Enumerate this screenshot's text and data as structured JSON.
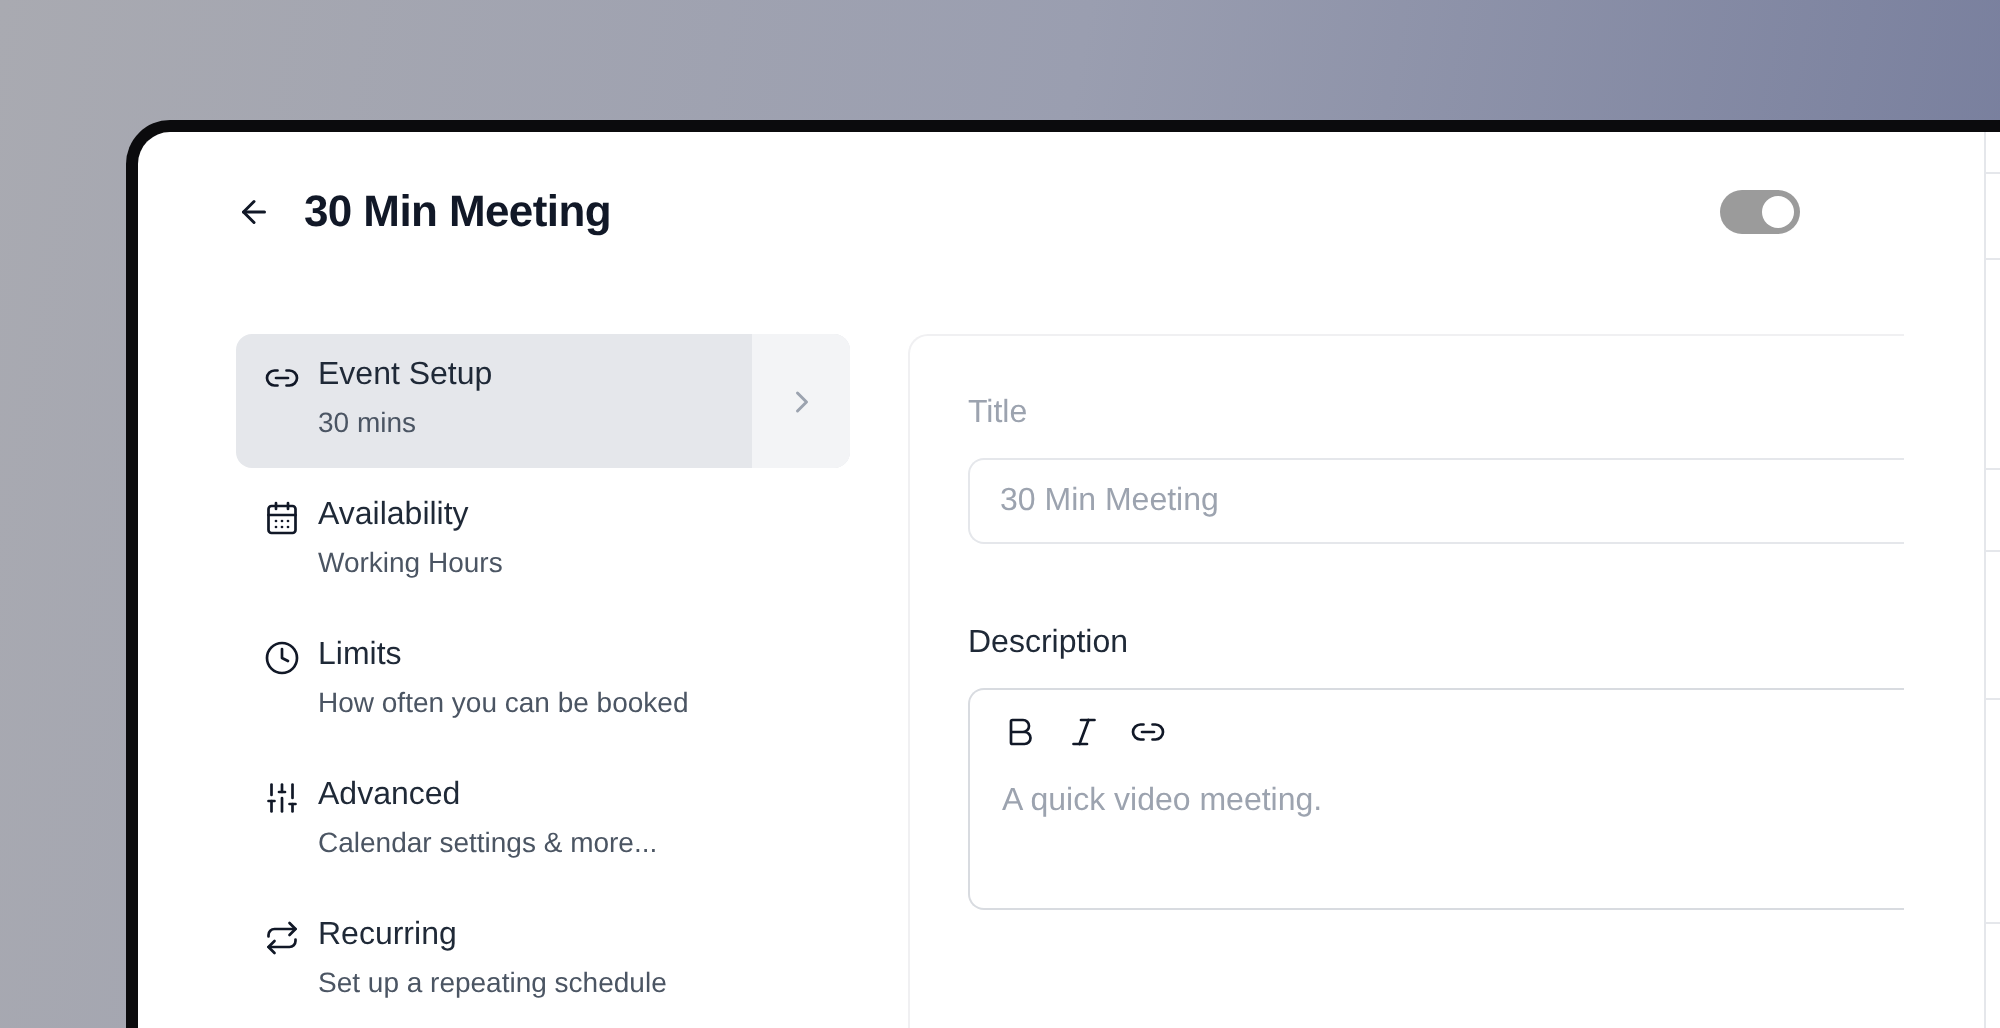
{
  "header": {
    "title": "30 Min Meeting",
    "toggle": {
      "on": true
    }
  },
  "sidebar": {
    "items": [
      {
        "kind": "link",
        "label": "Event Setup",
        "sublabel": "30 mins",
        "selected": true
      },
      {
        "kind": "calendar",
        "label": "Availability",
        "sublabel": "Working Hours",
        "selected": false
      },
      {
        "kind": "clock",
        "label": "Limits",
        "sublabel": "How often you can be booked",
        "selected": false
      },
      {
        "kind": "sliders",
        "label": "Advanced",
        "sublabel": "Calendar settings & more...",
        "selected": false
      },
      {
        "kind": "repeat",
        "label": "Recurring",
        "sublabel": "Set up a repeating schedule",
        "selected": false
      }
    ]
  },
  "form": {
    "title_label": "Title",
    "title_placeholder": "30 Min Meeting",
    "description_label": "Description",
    "description_placeholder": "A quick video meeting."
  }
}
